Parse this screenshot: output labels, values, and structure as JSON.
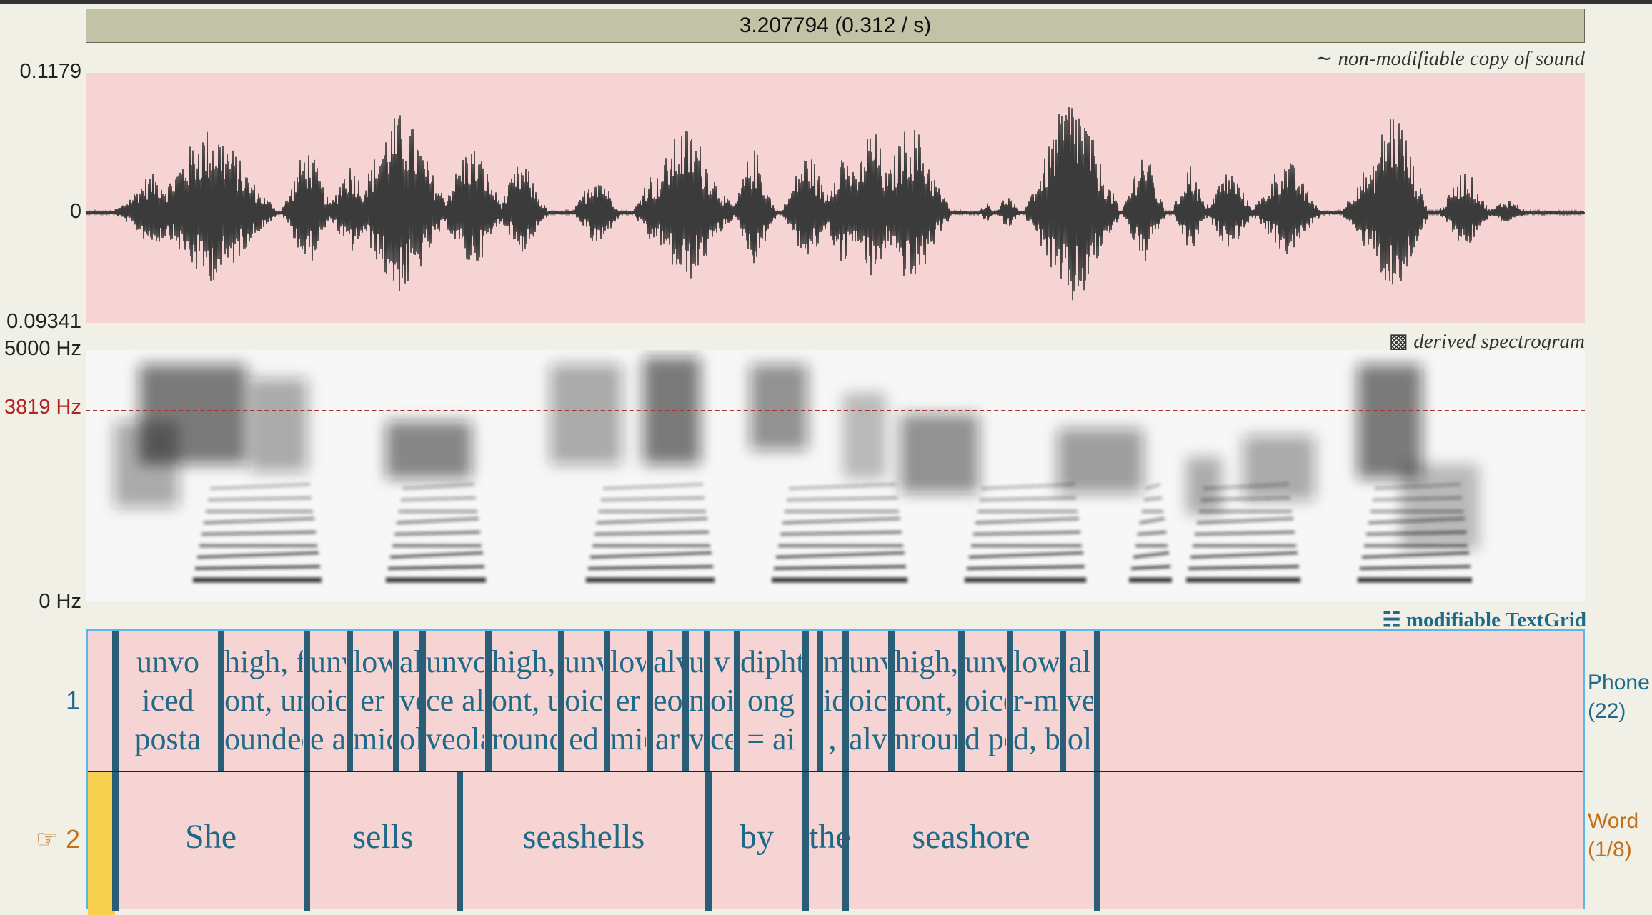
{
  "time_bar": "3.207794 (0.312 / s)",
  "wave": {
    "label": "non-modifiable copy of sound",
    "label_icon": "∼",
    "y_max": "0.1179",
    "y_zero": "0",
    "y_min": "0.09341"
  },
  "spectrogram": {
    "label": "derived spectrogram",
    "label_icon": "▩",
    "top": "5000 Hz",
    "cursor": "3819 Hz",
    "bottom": "0 Hz"
  },
  "textgrid": {
    "label": "modifiable TextGrid",
    "label_icon": "☵",
    "tier1": {
      "number": "1",
      "name": "Phone",
      "count": "(22)",
      "intervals": [
        {
          "lines": []
        },
        {
          "lines": [
            "unvo",
            "iced",
            "posta"
          ]
        },
        {
          "lines": [
            "high, fr",
            "ont, unr",
            "ounded"
          ]
        },
        {
          "lines": [
            "unv",
            "oic",
            "e al"
          ]
        },
        {
          "lines": [
            "low",
            "er",
            "mid"
          ]
        },
        {
          "lines": [
            "al",
            "ve",
            "ol"
          ]
        },
        {
          "lines": [
            "unvoi",
            "ce al",
            "veola"
          ]
        },
        {
          "lines": [
            "high, fr",
            "ont, un",
            "rounde"
          ]
        },
        {
          "lines": [
            "unv",
            "oic",
            "ed"
          ]
        },
        {
          "lines": [
            "low",
            "er",
            "mid"
          ]
        },
        {
          "lines": [
            "alv",
            "eol",
            "ar"
          ]
        },
        {
          "lines": [
            "u",
            "n",
            "v"
          ]
        },
        {
          "lines": [
            "v",
            "oi",
            "ce"
          ]
        },
        {
          "lines": [
            "diphth",
            "ong",
            "= ai"
          ]
        },
        {
          "lines": []
        },
        {
          "lines": [
            "m",
            "id",
            ","
          ]
        },
        {
          "lines": [
            "unv",
            "oice",
            "alv"
          ]
        },
        {
          "lines": [
            "high, f",
            "ront, u",
            "nroun"
          ]
        },
        {
          "lines": [
            "unv",
            "oice",
            "d po"
          ]
        },
        {
          "lines": [
            "lowe",
            "r-mi",
            "d, ba"
          ]
        },
        {
          "lines": [
            "al",
            "ve",
            "ol"
          ]
        },
        {
          "lines": []
        }
      ]
    },
    "tier2": {
      "number": "2",
      "pointer_icon": "☞",
      "name": "Word",
      "count": "(1/8)",
      "intervals": [
        {
          "text": ""
        },
        {
          "text": "She"
        },
        {
          "text": "sells"
        },
        {
          "text": "seashells"
        },
        {
          "text": "by"
        },
        {
          "text": "the"
        },
        {
          "text": "seashore"
        },
        {
          "text": ""
        }
      ]
    }
  },
  "colors": {
    "background": "#f1f0e6",
    "selection_pink": "#f6d4d4",
    "boundary": "#2a5e76",
    "tier_text": "#1e6a88",
    "selected_tier": "#c2701a",
    "cursor_red": "#b22222",
    "selected_interval": "#f5d04f"
  }
}
